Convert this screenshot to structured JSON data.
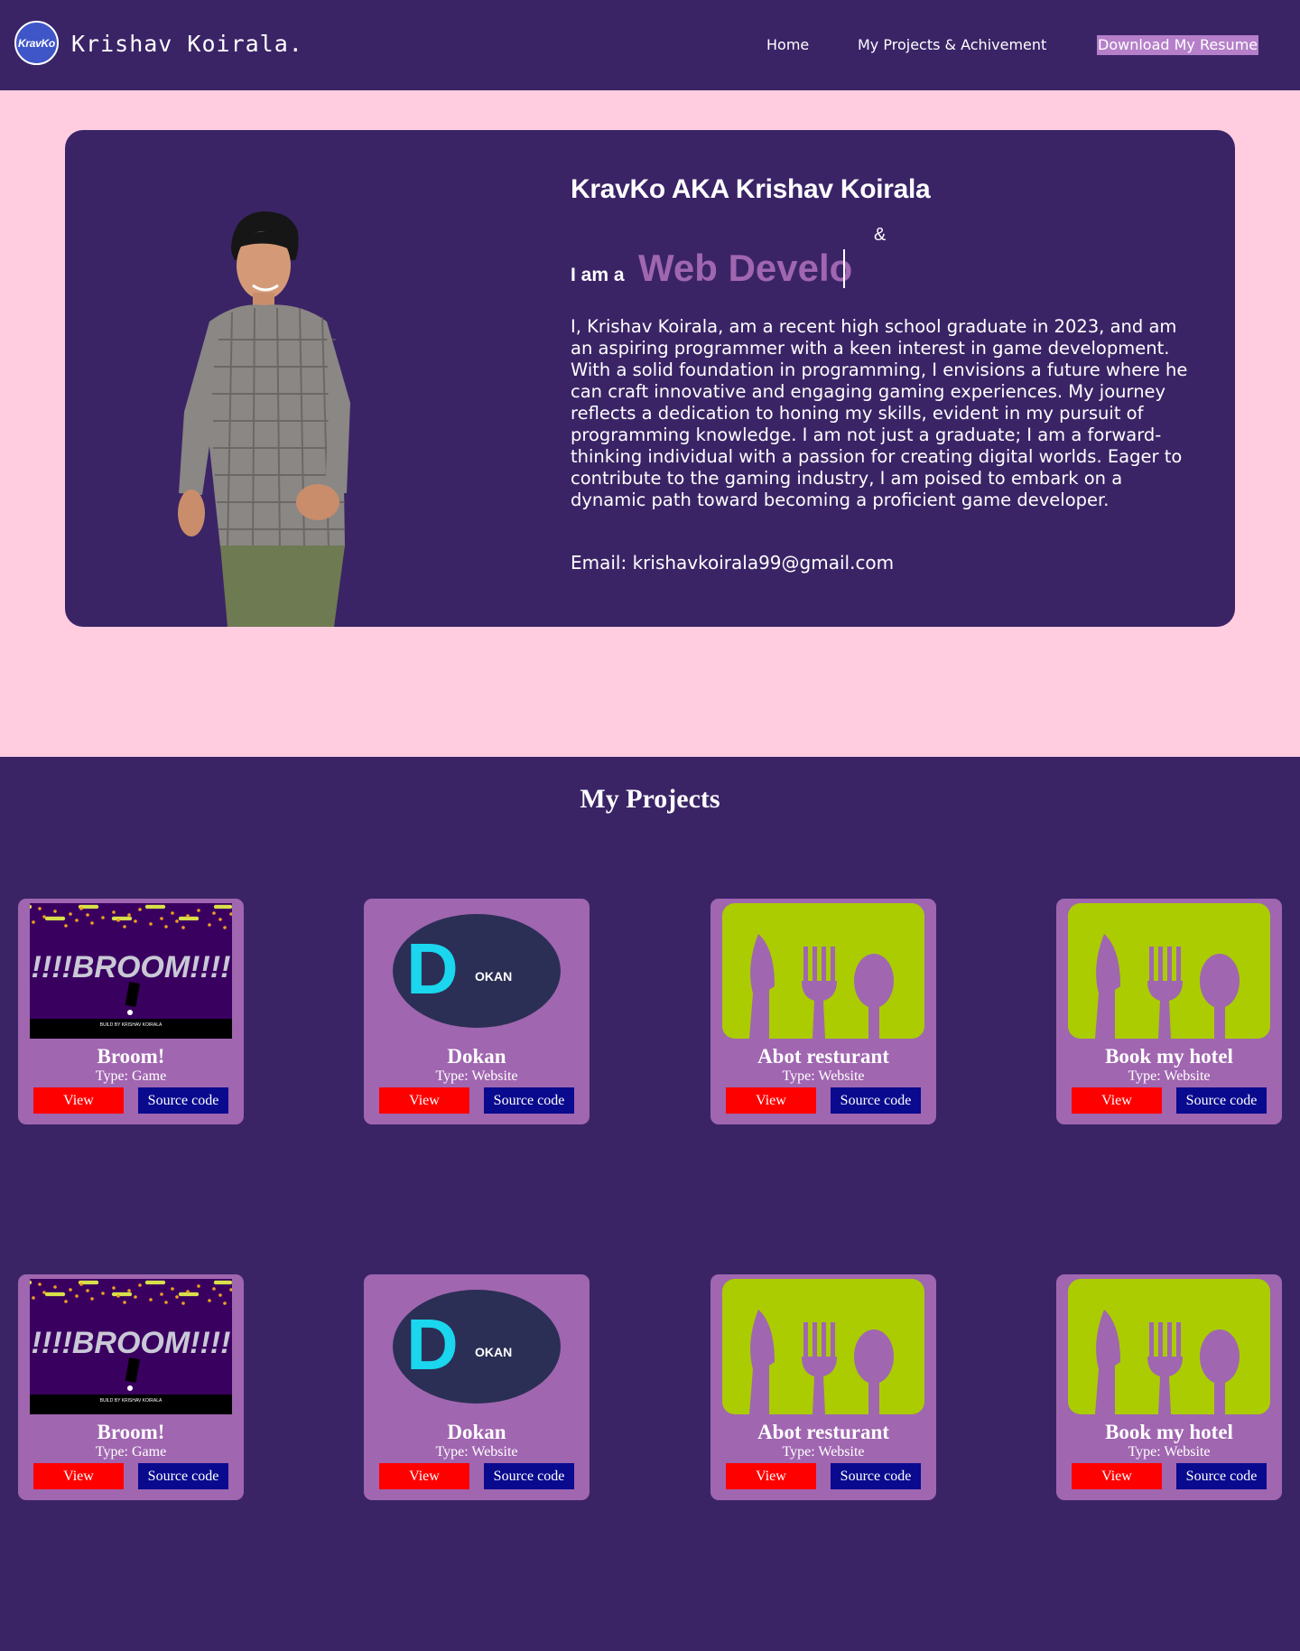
{
  "header": {
    "logo_text": "KravKo",
    "site_name": "Krishav Koirala.",
    "nav": [
      {
        "label": "Home"
      },
      {
        "label": "My Projects & Achivement"
      },
      {
        "label": "Download My Resume"
      }
    ]
  },
  "hero": {
    "title": "KravKo AKA Krishav Koirala",
    "ampersand": "&",
    "i_am": "I am a",
    "typed_text": "Web Develo",
    "bio": "I, Krishav Koirala, am a recent high school graduate in 2023, and am an aspiring programmer with a keen interest in game development. With a solid foundation in programming, I envisions a future where he can craft innovative and engaging gaming experiences. My journey reflects a dedication to honing my skills, evident in my pursuit of programming knowledge. I am not just a graduate; I am a forward-thinking individual with a passion for creating digital worlds. Eager to contribute to the gaming industry, I am poised to embark on a dynamic path toward becoming a proficient game developer.",
    "email": "Email: krishavkoirala99@gmail.com"
  },
  "projects": {
    "title": "My Projects",
    "items": [
      {
        "title": "Broom!",
        "type": "Type: Game",
        "thumb": "broom",
        "view": "View",
        "source": "Source code",
        "thumb_text": "!!!!BROOM!!!!",
        "thumb_credit": "BUILD BY KRISHAV KOIRALA"
      },
      {
        "title": "Dokan",
        "type": "Type: Website",
        "thumb": "dokan",
        "view": "View",
        "source": "Source code",
        "thumb_letter": "D",
        "thumb_text": "OKAN"
      },
      {
        "title": "Abot resturant",
        "type": "Type: Website",
        "thumb": "restaurant",
        "view": "View",
        "source": "Source code"
      },
      {
        "title": "Book my hotel",
        "type": "Type: Website",
        "thumb": "restaurant",
        "view": "View",
        "source": "Source code"
      },
      {
        "title": "Broom!",
        "type": "Type: Game",
        "thumb": "broom",
        "view": "View",
        "source": "Source code",
        "thumb_text": "!!!!BROOM!!!!",
        "thumb_credit": "BUILD BY KRISHAV KOIRALA"
      },
      {
        "title": "Dokan",
        "type": "Type: Website",
        "thumb": "dokan",
        "view": "View",
        "source": "Source code",
        "thumb_letter": "D",
        "thumb_text": "OKAN"
      },
      {
        "title": "Abot resturant",
        "type": "Type: Website",
        "thumb": "restaurant",
        "view": "View",
        "source": "Source code"
      },
      {
        "title": "Book my hotel",
        "type": "Type: Website",
        "thumb": "restaurant",
        "view": "View",
        "source": "Source code"
      }
    ]
  },
  "colors": {
    "nav_bg": "#3a2466",
    "hero_bg": "#ffcce0",
    "card_bg": "#a066b0",
    "view_button": "#ff0000",
    "source_button": "#0a0a8f",
    "resume_highlight": "#b57fc9",
    "restaurant_green": "#aacc00"
  }
}
